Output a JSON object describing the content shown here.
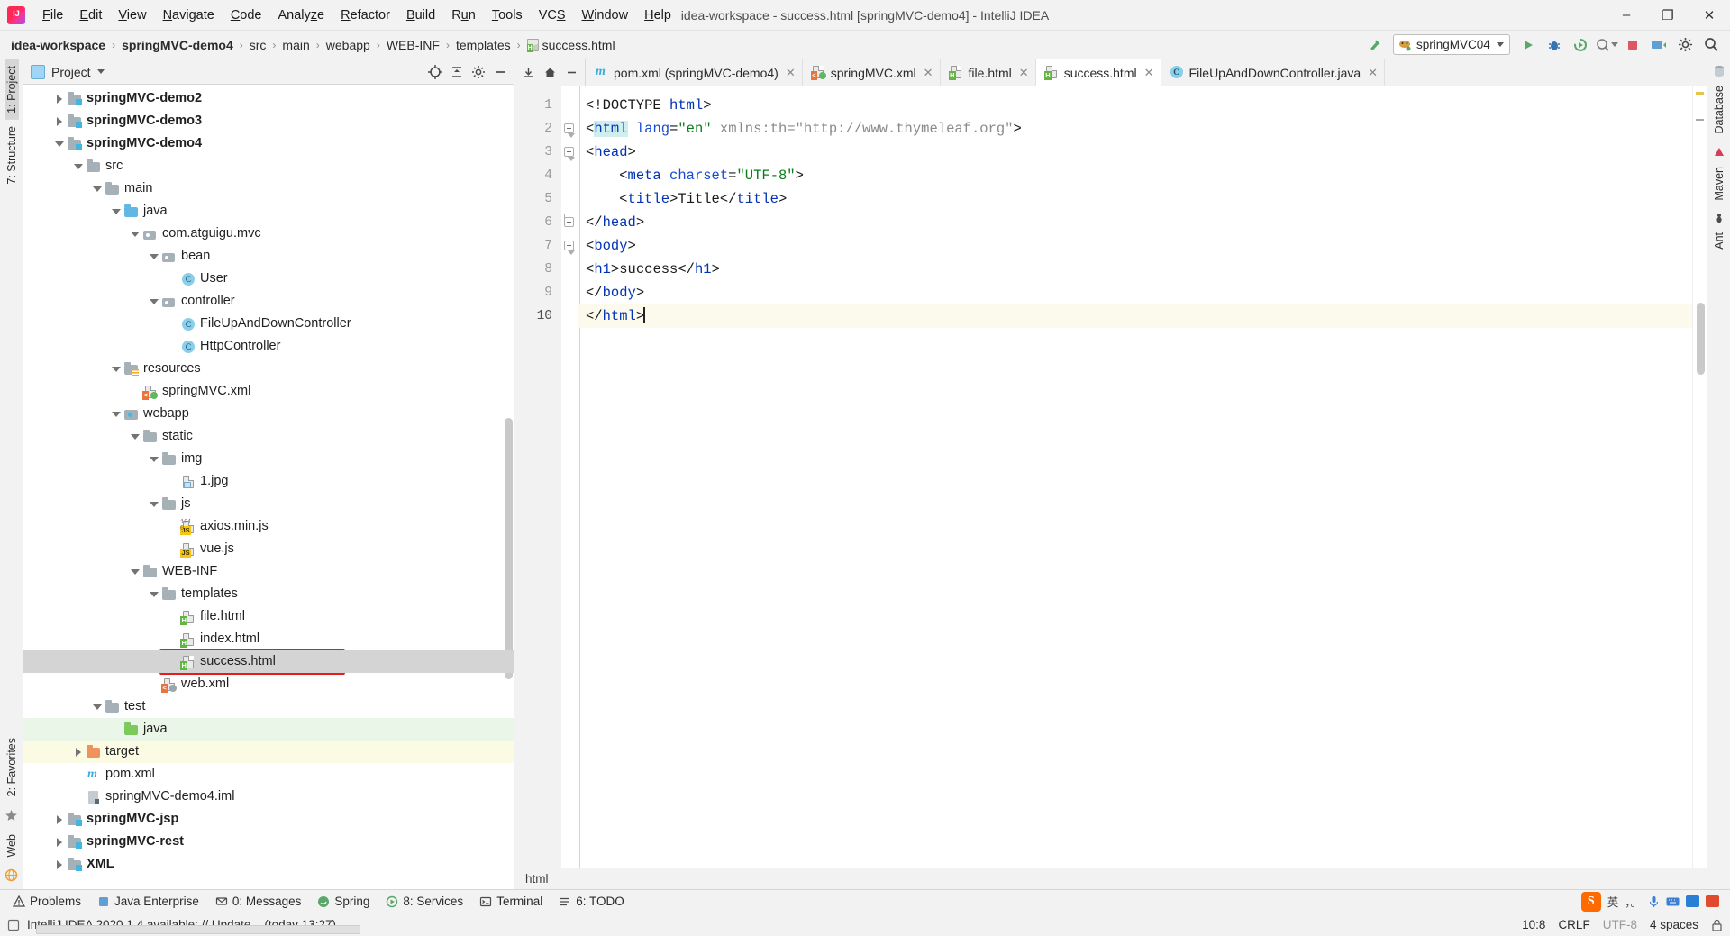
{
  "window": {
    "title": "idea-workspace - success.html [springMVC-demo4] - IntelliJ IDEA",
    "minimize": "–",
    "maximize": "❐",
    "close": "✕"
  },
  "menu": {
    "items": [
      {
        "label": "File"
      },
      {
        "label": "Edit"
      },
      {
        "label": "View"
      },
      {
        "label": "Navigate"
      },
      {
        "label": "Code"
      },
      {
        "label": "Analyze"
      },
      {
        "label": "Refactor"
      },
      {
        "label": "Build"
      },
      {
        "label": "Run"
      },
      {
        "label": "Tools"
      },
      {
        "label": "VCS"
      },
      {
        "label": "Window"
      },
      {
        "label": "Help"
      }
    ]
  },
  "navbar": {
    "crumbs": [
      {
        "label": "idea-workspace",
        "bold": true
      },
      {
        "label": "springMVC-demo4",
        "bold": true
      },
      {
        "label": "src",
        "bold": false
      },
      {
        "label": "main",
        "bold": false
      },
      {
        "label": "webapp",
        "bold": false
      },
      {
        "label": "WEB-INF",
        "bold": false
      },
      {
        "label": "templates",
        "bold": false
      },
      {
        "label": "success.html",
        "bold": false
      }
    ],
    "separator": "›",
    "run_config": "springMVC04",
    "icons": {
      "hammer": "build-icon",
      "run": "run-icon",
      "debug": "debug-icon",
      "coverage": "run-with-coverage-icon",
      "profiler": "profiler-icon",
      "stop": "stop-icon",
      "update": "update-app-icon",
      "settings": "settings-icon",
      "search": "search-everywhere-icon"
    }
  },
  "left_strip": {
    "tabs": [
      {
        "label": "1: Project",
        "selected": true
      },
      {
        "label": "7: Structure",
        "selected": false
      }
    ],
    "bottom": [
      {
        "label": "2: Favorites"
      },
      {
        "label": "Web"
      }
    ]
  },
  "right_strip": {
    "tabs": [
      {
        "label": "Database"
      },
      {
        "label": "Maven"
      },
      {
        "label": "Ant"
      }
    ]
  },
  "project": {
    "header": "Project",
    "tree": [
      {
        "label": "springMVC-demo2",
        "indent": 1,
        "arrow": "closed",
        "icon": "module",
        "bold": true,
        "state": ""
      },
      {
        "label": "springMVC-demo3",
        "indent": 1,
        "arrow": "closed",
        "icon": "module",
        "bold": true,
        "state": ""
      },
      {
        "label": "springMVC-demo4",
        "indent": 1,
        "arrow": "open",
        "icon": "module",
        "bold": true,
        "state": ""
      },
      {
        "label": "src",
        "indent": 2,
        "arrow": "open",
        "icon": "folder-gray",
        "bold": false,
        "state": ""
      },
      {
        "label": "main",
        "indent": 3,
        "arrow": "open",
        "icon": "folder-gray",
        "bold": false,
        "state": ""
      },
      {
        "label": "java",
        "indent": 4,
        "arrow": "open",
        "icon": "folder-blue",
        "bold": false,
        "state": ""
      },
      {
        "label": "com.atguigu.mvc",
        "indent": 5,
        "arrow": "open",
        "icon": "package",
        "bold": false,
        "state": ""
      },
      {
        "label": "bean",
        "indent": 6,
        "arrow": "open",
        "icon": "package",
        "bold": false,
        "state": ""
      },
      {
        "label": "User",
        "indent": 7,
        "arrow": "none",
        "icon": "class",
        "bold": false,
        "state": ""
      },
      {
        "label": "controller",
        "indent": 6,
        "arrow": "open",
        "icon": "package",
        "bold": false,
        "state": ""
      },
      {
        "label": "FileUpAndDownController",
        "indent": 7,
        "arrow": "none",
        "icon": "class",
        "bold": false,
        "state": ""
      },
      {
        "label": "HttpController",
        "indent": 7,
        "arrow": "none",
        "icon": "class",
        "bold": false,
        "state": ""
      },
      {
        "label": "resources",
        "indent": 4,
        "arrow": "open",
        "icon": "folder-resources",
        "bold": false,
        "state": ""
      },
      {
        "label": "springMVC.xml",
        "indent": 5,
        "arrow": "none",
        "icon": "xml-spring",
        "bold": false,
        "state": ""
      },
      {
        "label": "webapp",
        "indent": 4,
        "arrow": "open",
        "icon": "webapp",
        "bold": false,
        "state": ""
      },
      {
        "label": "static",
        "indent": 5,
        "arrow": "open",
        "icon": "folder-gray",
        "bold": false,
        "state": ""
      },
      {
        "label": "img",
        "indent": 6,
        "arrow": "open",
        "icon": "folder-gray",
        "bold": false,
        "state": ""
      },
      {
        "label": "1.jpg",
        "indent": 7,
        "arrow": "none",
        "icon": "image",
        "bold": false,
        "state": ""
      },
      {
        "label": "js",
        "indent": 6,
        "arrow": "open",
        "icon": "folder-gray",
        "bold": false,
        "state": ""
      },
      {
        "label": "axios.min.js",
        "indent": 7,
        "arrow": "none",
        "icon": "js-min",
        "bold": false,
        "state": ""
      },
      {
        "label": "vue.js",
        "indent": 7,
        "arrow": "none",
        "icon": "js",
        "bold": false,
        "state": ""
      },
      {
        "label": "WEB-INF",
        "indent": 5,
        "arrow": "open",
        "icon": "folder-gray",
        "bold": false,
        "state": ""
      },
      {
        "label": "templates",
        "indent": 6,
        "arrow": "open",
        "icon": "folder-gray",
        "bold": false,
        "state": ""
      },
      {
        "label": "file.html",
        "indent": 7,
        "arrow": "none",
        "icon": "html",
        "bold": false,
        "state": ""
      },
      {
        "label": "index.html",
        "indent": 7,
        "arrow": "none",
        "icon": "html",
        "bold": false,
        "state": ""
      },
      {
        "label": "success.html",
        "indent": 7,
        "arrow": "none",
        "icon": "html",
        "bold": false,
        "state": "selected"
      },
      {
        "label": "web.xml",
        "indent": 6,
        "arrow": "none",
        "icon": "xml-web",
        "bold": false,
        "state": ""
      },
      {
        "label": "test",
        "indent": 3,
        "arrow": "open",
        "icon": "folder-gray",
        "bold": false,
        "state": ""
      },
      {
        "label": "java",
        "indent": 4,
        "arrow": "none",
        "icon": "folder-green",
        "bold": false,
        "state": "green"
      },
      {
        "label": "target",
        "indent": 2,
        "arrow": "closed",
        "icon": "folder-orange",
        "bold": false,
        "state": "yellow"
      },
      {
        "label": "pom.xml",
        "indent": 2,
        "arrow": "none",
        "icon": "maven",
        "bold": false,
        "state": ""
      },
      {
        "label": "springMVC-demo4.iml",
        "indent": 2,
        "arrow": "none",
        "icon": "iml",
        "bold": false,
        "state": ""
      },
      {
        "label": "springMVC-jsp",
        "indent": 1,
        "arrow": "closed",
        "icon": "module",
        "bold": true,
        "state": ""
      },
      {
        "label": "springMVC-rest",
        "indent": 1,
        "arrow": "closed",
        "icon": "module",
        "bold": true,
        "state": ""
      },
      {
        "label": "XML",
        "indent": 1,
        "arrow": "closed",
        "icon": "module",
        "bold": true,
        "state": ""
      }
    ]
  },
  "editor": {
    "tabs": [
      {
        "label": "pom.xml (springMVC-demo4)",
        "icon": "maven-icon",
        "active": false
      },
      {
        "label": "springMVC.xml",
        "icon": "spring-xml-icon",
        "active": false
      },
      {
        "label": "file.html",
        "icon": "html-icon",
        "active": false
      },
      {
        "label": "success.html",
        "icon": "html-icon",
        "active": true
      },
      {
        "label": "FileUpAndDownController.java",
        "icon": "class-icon",
        "active": false
      }
    ],
    "close_glyph": "✕",
    "line_numbers": [
      "1",
      "2",
      "3",
      "4",
      "5",
      "6",
      "7",
      "8",
      "9",
      "10"
    ],
    "lines": [
      {
        "n": 1,
        "tokens": [
          {
            "t": "<!DOCTYPE ",
            "c": "tok-punc"
          },
          {
            "t": "html",
            "c": "tok-tag"
          },
          {
            "t": ">",
            "c": "tok-punc"
          }
        ]
      },
      {
        "n": 2,
        "tokens": [
          {
            "t": "<",
            "c": "tok-punc"
          },
          {
            "t": "html",
            "c": "tok-tag hl-html"
          },
          {
            "t": " ",
            "c": "tok-punc"
          },
          {
            "t": "lang",
            "c": "tok-attr"
          },
          {
            "t": "=",
            "c": "tok-punc"
          },
          {
            "t": "\"en\"",
            "c": "tok-str"
          },
          {
            "t": " ",
            "c": "tok-punc"
          },
          {
            "t": "xmlns:th",
            "c": "tok-url"
          },
          {
            "t": "=",
            "c": "tok-url"
          },
          {
            "t": "\"http://www.thymeleaf.org\"",
            "c": "tok-url"
          },
          {
            "t": ">",
            "c": "tok-punc"
          }
        ]
      },
      {
        "n": 3,
        "tokens": [
          {
            "t": "<",
            "c": "tok-punc"
          },
          {
            "t": "head",
            "c": "tok-tag"
          },
          {
            "t": ">",
            "c": "tok-punc"
          }
        ]
      },
      {
        "n": 4,
        "tokens": [
          {
            "t": "    <",
            "c": "tok-punc"
          },
          {
            "t": "meta",
            "c": "tok-tag"
          },
          {
            "t": " ",
            "c": "tok-punc"
          },
          {
            "t": "charset",
            "c": "tok-attr"
          },
          {
            "t": "=",
            "c": "tok-punc"
          },
          {
            "t": "\"UTF-8\"",
            "c": "tok-str"
          },
          {
            "t": ">",
            "c": "tok-punc"
          }
        ]
      },
      {
        "n": 5,
        "tokens": [
          {
            "t": "    <",
            "c": "tok-punc"
          },
          {
            "t": "title",
            "c": "tok-tag"
          },
          {
            "t": ">",
            "c": "tok-punc"
          },
          {
            "t": "Title",
            "c": "tok-txt"
          },
          {
            "t": "</",
            "c": "tok-punc"
          },
          {
            "t": "title",
            "c": "tok-tag"
          },
          {
            "t": ">",
            "c": "tok-punc"
          }
        ]
      },
      {
        "n": 6,
        "tokens": [
          {
            "t": "</",
            "c": "tok-punc"
          },
          {
            "t": "head",
            "c": "tok-tag"
          },
          {
            "t": ">",
            "c": "tok-punc"
          }
        ]
      },
      {
        "n": 7,
        "tokens": [
          {
            "t": "<",
            "c": "tok-punc"
          },
          {
            "t": "body",
            "c": "tok-tag"
          },
          {
            "t": ">",
            "c": "tok-punc"
          }
        ]
      },
      {
        "n": 8,
        "tokens": [
          {
            "t": "<",
            "c": "tok-punc"
          },
          {
            "t": "h1",
            "c": "tok-tag"
          },
          {
            "t": ">",
            "c": "tok-punc"
          },
          {
            "t": "success",
            "c": "tok-txt"
          },
          {
            "t": "</",
            "c": "tok-punc"
          },
          {
            "t": "h1",
            "c": "tok-tag"
          },
          {
            "t": ">",
            "c": "tok-punc"
          }
        ]
      },
      {
        "n": 9,
        "tokens": [
          {
            "t": "</",
            "c": "tok-punc"
          },
          {
            "t": "body",
            "c": "tok-tag"
          },
          {
            "t": ">",
            "c": "tok-punc"
          }
        ]
      },
      {
        "n": 10,
        "tokens": [
          {
            "t": "</",
            "c": "tok-punc"
          },
          {
            "t": "html",
            "c": "tok-tag"
          },
          {
            "t": ">",
            "c": "tok-punc"
          }
        ]
      }
    ],
    "breadcrumb": "html"
  },
  "tool_windows": {
    "items": [
      {
        "label": "Problems",
        "icon": "warning-icon"
      },
      {
        "label": "Java Enterprise",
        "icon": "java-ee-icon"
      },
      {
        "label": "0: Messages",
        "icon": "messages-icon"
      },
      {
        "label": "Spring",
        "icon": "spring-icon"
      },
      {
        "label": "8: Services",
        "icon": "services-icon"
      },
      {
        "label": "Terminal",
        "icon": "terminal-icon"
      },
      {
        "label": "6: TODO",
        "icon": "todo-icon"
      }
    ]
  },
  "status": {
    "message": "IntelliJ IDEA 2020.1.4 available: // Update... (today 13:27)",
    "caret": "10:8",
    "line_separator": "CRLF",
    "encoding": "UTF-8",
    "indent": "4 spaces",
    "ime": {
      "lang": "英",
      "punct": "，。",
      "mic": "mic-icon",
      "keyboard": "keyboard-icon",
      "toolbox": "toolbox-icon",
      "settings": "ime-settings-icon"
    }
  },
  "colors": {
    "selection": "#d4d4d4",
    "annotation": "#e81b1b",
    "accent_blue": "#0033b3",
    "string_green": "#067d17",
    "test_source": "#eaf6e8",
    "excluded": "#fbfbe3"
  }
}
